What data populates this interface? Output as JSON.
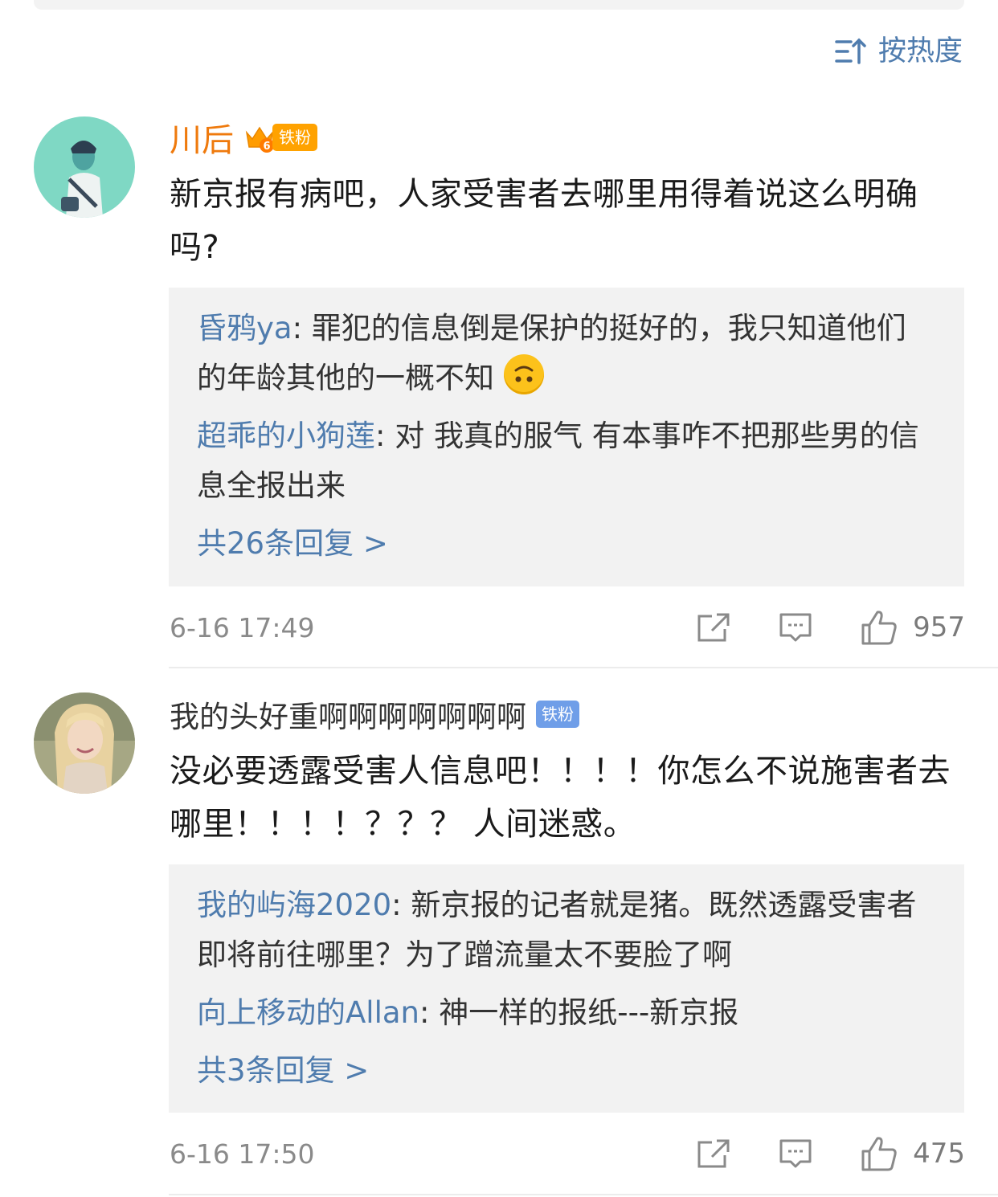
{
  "sort": {
    "label": "按热度",
    "icon": "sort-desc-icon"
  },
  "comments": [
    {
      "username": "川后",
      "badge": "铁粉",
      "level": "6",
      "text": "新京报有病吧，人家受害者去哪里用得着说这么明确吗?",
      "replies": [
        {
          "name": "昏鸦ya",
          "text": ": 罪犯的信息倒是保护的挺好的，我只知道他们的年龄其他的一概不知",
          "emoji": "upside-down-face"
        },
        {
          "name": "超乖的小狗莲",
          "text": ": 对 我真的服气 有本事咋不把那些男的信息全报出来"
        }
      ],
      "more_replies": "共26条回复 >",
      "time": "6-16 17:49",
      "likes": "957"
    },
    {
      "username": "我的头好重啊啊啊啊啊啊啊",
      "badge": "铁粉",
      "text": "没必要透露受害人信息吧！！！！你怎么不说施害者去哪里！！！！？？？ 人间迷惑。",
      "replies": [
        {
          "name": "我的屿海2020",
          "text": ": 新京报的记者就是猪。既然透露受害者即将前往哪里？为了蹭流量太不要脸了啊"
        },
        {
          "name": "向上移动的Allan",
          "text": ": 神一样的报纸---新京报"
        }
      ],
      "more_replies": "共3条回复 >",
      "time": "6-16 17:50",
      "likes": "475"
    }
  ]
}
